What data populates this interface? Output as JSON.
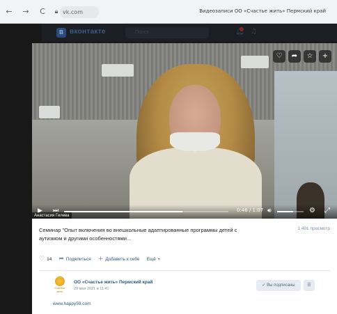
{
  "browser": {
    "back": "←",
    "forward": "→",
    "reload": "C",
    "url": "vk.com",
    "tab_title": "Видеозаписи ОО «Счастье жить» Пермский край"
  },
  "vk_header": {
    "logo_glyph": "B",
    "name": "вконтакте",
    "search_placeholder": "Поиск"
  },
  "video": {
    "caption": "Анастасия Гилева",
    "time": "0:46 / 1:07",
    "progress_fraction": 0.72,
    "volume_fraction": 0.6,
    "top_icons": [
      "heart-icon",
      "share-icon",
      "bookmark-icon",
      "add-icon"
    ]
  },
  "details": {
    "title": "Семинар \"Опыт включения во внешкольные адаптированные программы детей с аутизмом и другими особенностями...",
    "views": "1 401 просмотр",
    "like_count": "14",
    "share_label": "Поделиться",
    "add_label": "Добавить к себе",
    "more_label": "Ещё"
  },
  "channel": {
    "avatar_text": "Счастье жить",
    "name": "ОО «Счастье жить» Пермский край",
    "date": "29 мая 2021 в 11:41",
    "subscribe_label": "✓  Вы подписаны",
    "menu_label": "☰",
    "site_link": "www.happy59.com"
  },
  "colors": {
    "vk_blue": "#2a5885",
    "muted": "#818c99",
    "button_bg": "#e5ebf1"
  }
}
